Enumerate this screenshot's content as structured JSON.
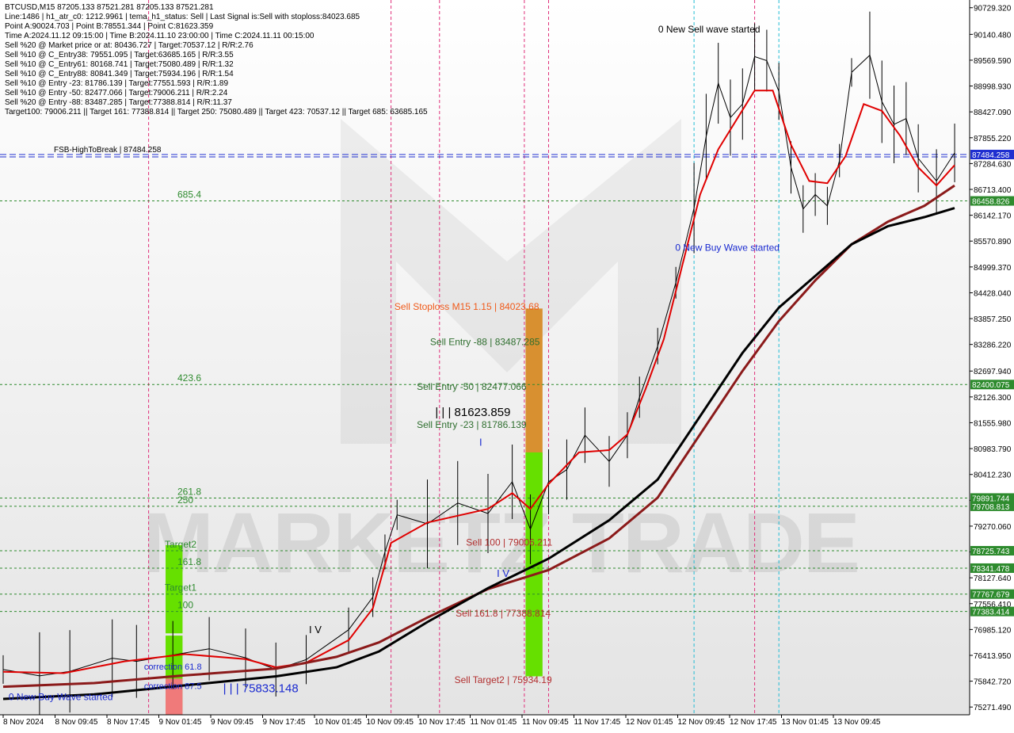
{
  "info_panel": {
    "lines": [
      "BTCUSD,M15  87205.133 87521.281 87205.133 87521.281",
      "Line:1486 | h1_atr_c0: 1212.9961 | tema_h1_status: Sell | Last Signal is:Sell with stoploss:84023.685",
      "Point A:90024.703 | Point B:78551.344 | Point C:81623.359",
      "Time A:2024.11.12 09:15:00 | Time B:2024.11.10 23:00:00 | Time C:2024.11.11 00:15:00",
      "Sell %20 @ Market price or at: 80436.727 | Target:70537.12 | R/R:2.76",
      "Sell %10 @ C_Entry38: 79551.095 | Target:63685.165 | R/R:3.55",
      "Sell %10 @ C_Entry61: 80168.741 | Target:75080.489 | R/R:1.32",
      "Sell %10 @ C_Entry88: 80841.349 | Target:75934.196 | R/R:1.54",
      "Sell %10 @ Entry -23: 81786.139 | Target:77551.593 | R/R:1.89",
      "Sell %10 @ Entry -50: 82477.066 | Target:79006.211 | R/R:2.24",
      "Sell %20 @ Entry -88: 83487.285 | Target:77388.814 | R/R:11.37",
      "Target100: 79006.211 || Target 161: 77388.814 || Target 250: 75080.489 || Target 423: 70537.12 || Target 685: 63685.165"
    ]
  },
  "chart_data": {
    "type": "line",
    "symbol": "BTCUSD",
    "timeframe": "M15",
    "y_axis_ticks": [
      "90729.320",
      "90140.480",
      "89569.590",
      "88998.930",
      "88427.090",
      "87855.220",
      "87284.630",
      "86713.400",
      "86142.170",
      "85570.890",
      "84999.370",
      "84428.040",
      "83857.250",
      "83286.220",
      "82697.940",
      "82126.300",
      "81555.980",
      "80983.790",
      "80412.230",
      "79841.070",
      "79270.060",
      "78699.400",
      "78127.640",
      "77556.410",
      "76985.120",
      "76413.950",
      "75842.720",
      "75271.490"
    ],
    "ylim": [
      75100,
      90900
    ],
    "x_axis_ticks": [
      "8 Nov 2024",
      "8 Nov 09:45",
      "8 Nov 17:45",
      "9 Nov 01:45",
      "9 Nov 09:45",
      "9 Nov 17:45",
      "10 Nov 01:45",
      "10 Nov 09:45",
      "10 Nov 17:45",
      "11 Nov 01:45",
      "11 Nov 09:45",
      "11 Nov 17:45",
      "12 Nov 01:45",
      "12 Nov 09:45",
      "12 Nov 17:45",
      "13 Nov 01:45",
      "13 Nov 09:45"
    ],
    "price_tags": [
      {
        "label": "87484.258",
        "value": 87484.258,
        "bg": "#1f2fd0"
      },
      {
        "label": "86458.826",
        "value": 86458.826,
        "bg": "#2e8b2e"
      },
      {
        "label": "82400.075",
        "value": 82400.075,
        "bg": "#2e8b2e"
      },
      {
        "label": "79891.744",
        "value": 79891.744,
        "bg": "#2e8b2e"
      },
      {
        "label": "79708.813",
        "value": 79708.813,
        "bg": "#2e8b2e"
      },
      {
        "label": "78725.743",
        "value": 78725.743,
        "bg": "#2e8b2e"
      },
      {
        "label": "78341.478",
        "value": 78341.478,
        "bg": "#2e8b2e"
      },
      {
        "label": "77767.679",
        "value": 77767.679,
        "bg": "#2e8b2e"
      },
      {
        "label": "77383.414",
        "value": 77383.414,
        "bg": "#2e8b2e"
      }
    ],
    "green_levels": [
      {
        "name": "685.4",
        "value": 86458.826
      },
      {
        "name": "423.6",
        "value": 82400.075
      },
      {
        "name": "261.8",
        "value": 79891.744
      },
      {
        "name": "250",
        "value": 79708.813
      },
      {
        "name": "Target2",
        "value": 78725.743
      },
      {
        "name": "161.8",
        "value": 78341.478
      },
      {
        "name": "Target1",
        "value": 77767.679
      },
      {
        "name": "100",
        "value": 77383.414
      }
    ],
    "fsb_line": {
      "label": "FSB-HighToBreak | 87484.258",
      "value": 87484.258
    },
    "price_series": [
      {
        "t": 0,
        "v": 76100
      },
      {
        "t": 6,
        "v": 75960
      },
      {
        "t": 11,
        "v": 76060
      },
      {
        "t": 18,
        "v": 76350
      },
      {
        "t": 22,
        "v": 76280
      },
      {
        "t": 28,
        "v": 76420
      },
      {
        "t": 34,
        "v": 76560
      },
      {
        "t": 40,
        "v": 76360
      },
      {
        "t": 45,
        "v": 76100
      },
      {
        "t": 50,
        "v": 76320
      },
      {
        "t": 57,
        "v": 76980
      },
      {
        "t": 61,
        "v": 77700
      },
      {
        "t": 63,
        "v": 78700
      },
      {
        "t": 65,
        "v": 79520
      },
      {
        "t": 70,
        "v": 79320
      },
      {
        "t": 75,
        "v": 79780
      },
      {
        "t": 80,
        "v": 79550
      },
      {
        "t": 84,
        "v": 80250
      },
      {
        "t": 87,
        "v": 79200
      },
      {
        "t": 90,
        "v": 80250
      },
      {
        "t": 93,
        "v": 80520
      },
      {
        "t": 96,
        "v": 81280
      },
      {
        "t": 100,
        "v": 80700
      },
      {
        "t": 103,
        "v": 81280
      },
      {
        "t": 105,
        "v": 82120
      },
      {
        "t": 108,
        "v": 83250
      },
      {
        "t": 111,
        "v": 84650
      },
      {
        "t": 114,
        "v": 86300
      },
      {
        "t": 116,
        "v": 87880
      },
      {
        "t": 118,
        "v": 89060
      },
      {
        "t": 120,
        "v": 88300
      },
      {
        "t": 122,
        "v": 88600
      },
      {
        "t": 124,
        "v": 89650
      },
      {
        "t": 126,
        "v": 89560
      },
      {
        "t": 128,
        "v": 88880
      },
      {
        "t": 130,
        "v": 87200
      },
      {
        "t": 132,
        "v": 86280
      },
      {
        "t": 134,
        "v": 86600
      },
      {
        "t": 136,
        "v": 86350
      },
      {
        "t": 138,
        "v": 87350
      },
      {
        "t": 140,
        "v": 89300
      },
      {
        "t": 143,
        "v": 89680
      },
      {
        "t": 145,
        "v": 88650
      },
      {
        "t": 147,
        "v": 88150
      },
      {
        "t": 149,
        "v": 88280
      },
      {
        "t": 151,
        "v": 87400
      },
      {
        "t": 154,
        "v": 86900
      },
      {
        "t": 157,
        "v": 87520
      }
    ],
    "series": [
      {
        "name": "fast",
        "color": "#e00000",
        "values": [
          {
            "t": 0,
            "v": 76050
          },
          {
            "t": 10,
            "v": 76020
          },
          {
            "t": 20,
            "v": 76280
          },
          {
            "t": 30,
            "v": 76440
          },
          {
            "t": 40,
            "v": 76330
          },
          {
            "t": 45,
            "v": 76150
          },
          {
            "t": 50,
            "v": 76250
          },
          {
            "t": 57,
            "v": 76750
          },
          {
            "t": 61,
            "v": 77450
          },
          {
            "t": 64,
            "v": 78900
          },
          {
            "t": 70,
            "v": 79350
          },
          {
            "t": 75,
            "v": 79500
          },
          {
            "t": 80,
            "v": 79650
          },
          {
            "t": 84,
            "v": 80000
          },
          {
            "t": 87,
            "v": 79650
          },
          {
            "t": 90,
            "v": 80200
          },
          {
            "t": 95,
            "v": 80900
          },
          {
            "t": 100,
            "v": 80950
          },
          {
            "t": 103,
            "v": 81300
          },
          {
            "t": 106,
            "v": 82300
          },
          {
            "t": 109,
            "v": 83400
          },
          {
            "t": 112,
            "v": 85000
          },
          {
            "t": 115,
            "v": 86600
          },
          {
            "t": 118,
            "v": 87600
          },
          {
            "t": 121,
            "v": 88250
          },
          {
            "t": 124,
            "v": 88900
          },
          {
            "t": 127,
            "v": 88900
          },
          {
            "t": 130,
            "v": 87700
          },
          {
            "t": 133,
            "v": 86900
          },
          {
            "t": 136,
            "v": 86850
          },
          {
            "t": 139,
            "v": 87450
          },
          {
            "t": 142,
            "v": 88600
          },
          {
            "t": 145,
            "v": 88450
          },
          {
            "t": 148,
            "v": 87900
          },
          {
            "t": 151,
            "v": 87200
          },
          {
            "t": 154,
            "v": 86800
          },
          {
            "t": 157,
            "v": 87250
          }
        ]
      },
      {
        "name": "mid",
        "color": "#8b1a1a",
        "values": [
          {
            "t": 0,
            "v": 75720
          },
          {
            "t": 15,
            "v": 75800
          },
          {
            "t": 30,
            "v": 75970
          },
          {
            "t": 45,
            "v": 76120
          },
          {
            "t": 55,
            "v": 76380
          },
          {
            "t": 62,
            "v": 76700
          },
          {
            "t": 70,
            "v": 77250
          },
          {
            "t": 80,
            "v": 77880
          },
          {
            "t": 90,
            "v": 78300
          },
          {
            "t": 100,
            "v": 79000
          },
          {
            "t": 108,
            "v": 79900
          },
          {
            "t": 116,
            "v": 81500
          },
          {
            "t": 122,
            "v": 82700
          },
          {
            "t": 128,
            "v": 83800
          },
          {
            "t": 134,
            "v": 84700
          },
          {
            "t": 140,
            "v": 85500
          },
          {
            "t": 146,
            "v": 86000
          },
          {
            "t": 152,
            "v": 86350
          },
          {
            "t": 157,
            "v": 86800
          }
        ]
      },
      {
        "name": "slow",
        "color": "#000000",
        "values": [
          {
            "t": 0,
            "v": 75450
          },
          {
            "t": 15,
            "v": 75550
          },
          {
            "t": 30,
            "v": 75750
          },
          {
            "t": 45,
            "v": 75950
          },
          {
            "t": 55,
            "v": 76150
          },
          {
            "t": 62,
            "v": 76500
          },
          {
            "t": 70,
            "v": 77150
          },
          {
            "t": 80,
            "v": 77900
          },
          {
            "t": 90,
            "v": 78550
          },
          {
            "t": 100,
            "v": 79400
          },
          {
            "t": 108,
            "v": 80300
          },
          {
            "t": 116,
            "v": 81900
          },
          {
            "t": 122,
            "v": 83100
          },
          {
            "t": 128,
            "v": 84100
          },
          {
            "t": 134,
            "v": 84800
          },
          {
            "t": 140,
            "v": 85500
          },
          {
            "t": 146,
            "v": 85900
          },
          {
            "t": 152,
            "v": 86100
          },
          {
            "t": 157,
            "v": 86300
          }
        ]
      }
    ],
    "vertical_lines": [
      {
        "t": 24,
        "color": "#e0307a"
      },
      {
        "t": 64,
        "color": "#e0307a"
      },
      {
        "t": 72,
        "color": "#e0307a"
      },
      {
        "t": 86,
        "color": "#e0307a"
      },
      {
        "t": 90,
        "color": "#e0307a"
      },
      {
        "t": 114,
        "color": "#22bcd4"
      },
      {
        "t": 124,
        "color": "#e0307a"
      },
      {
        "t": 128,
        "color": "#22bcd4"
      }
    ],
    "bars": [
      {
        "label": "Target2 bar",
        "t0": 26.8,
        "t1": 29.6,
        "v0": 76900,
        "v1": 78850,
        "color": "#66e000"
      },
      {
        "label": "Target1 bar",
        "t0": 26.8,
        "t1": 29.6,
        "v0": 75180,
        "v1": 76850,
        "color": "#66e000"
      },
      {
        "label": "red bar",
        "t0": 26.8,
        "t1": 29.6,
        "v0": 75100,
        "v1": 75900,
        "color": "#f07a7a"
      },
      {
        "label": "stoploss bar",
        "t0": 86.2,
        "t1": 89.0,
        "v0": 80500,
        "v1": 84080,
        "color": "#d89030"
      },
      {
        "label": "sell target bar",
        "t0": 86.2,
        "t1": 89.0,
        "v0": 75950,
        "v1": 80900,
        "color": "#66e000"
      }
    ],
    "annotations": [
      {
        "text": "0 New Sell wave started",
        "t": 116.5,
        "v": 90180,
        "color": "#000000",
        "size": 12
      },
      {
        "text": "0 New Buy Wave started",
        "t": 119.5,
        "v": 85360,
        "color": "#1a2ad0",
        "size": 12
      },
      {
        "text": "0 New Buy Wave started",
        "t": 9.5,
        "v": 75420,
        "color": "#1a2ad0",
        "size": 12
      },
      {
        "text": "Sell Stoploss M15 1.15 | 84023.68",
        "t": 76.5,
        "v": 84050,
        "color": "#f05a1a",
        "size": 12
      },
      {
        "text": "Sell Entry -88 | 83487.285",
        "t": 79.5,
        "v": 83270,
        "color": "#2e6e2e",
        "size": 12
      },
      {
        "text": "Sell Entry -50 | 82477.066",
        "t": 77.3,
        "v": 82280,
        "color": "#2e6e2e",
        "size": 12
      },
      {
        "text": "| | | 81623.859",
        "t": 77.5,
        "v": 81700,
        "color": "#000000",
        "size": 15
      },
      {
        "text": "Sell Entry -23 | 81786.139",
        "t": 77.3,
        "v": 81440,
        "color": "#2e6e2e",
        "size": 12
      },
      {
        "text": "Sell 100 | 79006.211",
        "t": 83.5,
        "v": 78840,
        "color": "#b23030",
        "size": 12
      },
      {
        "text": "Sell 161.8 | 77388.814",
        "t": 82.5,
        "v": 77270,
        "color": "#b23030",
        "size": 12
      },
      {
        "text": "Sell Target2 | 75934.19",
        "t": 82.5,
        "v": 75800,
        "color": "#b23030",
        "size": 12
      },
      {
        "text": "| | | 75833.148",
        "t": 42.5,
        "v": 75600,
        "color": "#1a2ad0",
        "size": 15
      },
      {
        "text": "correction 61.8",
        "t": 28.0,
        "v": 76100,
        "color": "#1a2ad0",
        "size": 11
      },
      {
        "text": "correction 87.5",
        "t": 28.0,
        "v": 75670,
        "color": "#1a2ad0",
        "size": 11
      },
      {
        "text": "I V",
        "t": 51.5,
        "v": 76900,
        "color": "#000000",
        "size": 13
      },
      {
        "text": "I V",
        "t": 82.5,
        "v": 78150,
        "color": "#1a2ad0",
        "size": 13
      },
      {
        "text": "I",
        "t": 78.8,
        "v": 81050,
        "color": "#1a2ad0",
        "size": 13
      }
    ],
    "watermark": "MARKETZ TRADE",
    "grid": true
  }
}
